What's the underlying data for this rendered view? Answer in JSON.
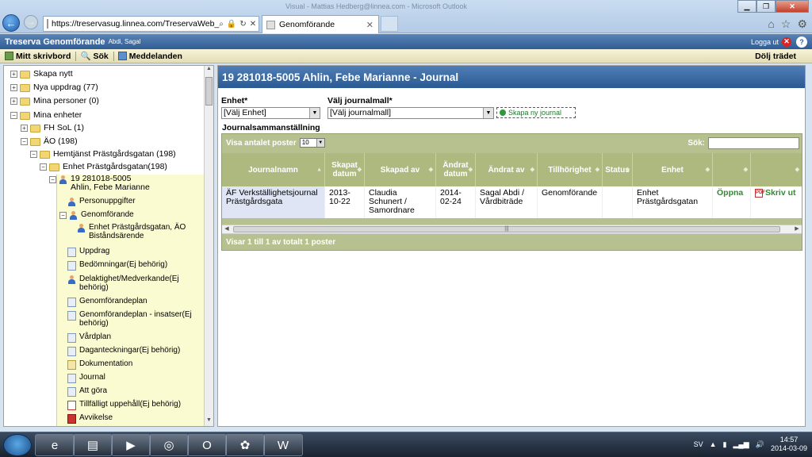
{
  "browser": {
    "window_title": "Visual - Mattias Hedberg@linnea.com - Microsoft Outlook",
    "address": "https://treservasug.linnea.com/TreservaWeb_",
    "tab_label": "Genomförande",
    "back_glyph": "←",
    "forward_glyph": "→"
  },
  "app": {
    "title": "Treserva Genomförande",
    "user": "Abdi, Sagal",
    "logout": "Logga ut"
  },
  "toolbar": {
    "my_desk": "Mitt skrivbord",
    "search": "Sök",
    "messages": "Meddelanden",
    "hide_tree": "Dölj trädet"
  },
  "tree": {
    "create_new": "Skapa nytt",
    "new_tasks": "Nya uppdrag (77)",
    "my_persons": "Mina personer (0)",
    "my_units": "Mina enheter",
    "fh_sol": "FH SoL (1)",
    "ao": "ÄO (198)",
    "hemtjanst": "Hemtjänst Prästgårdsgatan (198)",
    "enhet": "Enhet Prästgårdsgatan(198)",
    "person_id": "19 281018-5005",
    "person_name": "Ahlin, Febe Marianne",
    "sub_items": [
      "Personuppgifter",
      "Genomförande",
      "Enhet Prästgårdsgatan, ÄO Biståndsärende",
      "Uppdrag",
      "Bedömningar(Ej behörig)",
      "Delaktighet/Medverkande(Ej behörig)",
      "Genomförandeplan",
      "Genomförandeplan - insatser(Ej behörig)",
      "Vårdplan",
      "Daganteckningar(Ej behörig)",
      "Dokumentation",
      "Journal",
      "Att göra",
      "Tillfälligt uppehåll(Ej behörig)",
      "Avvikelse"
    ]
  },
  "main": {
    "heading": "19 281018-5005 Ahlin, Febe Marianne - Journal",
    "unit_label": "Enhet*",
    "unit_value": "[Välj Enhet]",
    "template_label": "Välj journalmall*",
    "template_value": "[Välj journalmall]",
    "new_journal": "Skapa ny journal",
    "summary_title": "Journalsammanställning",
    "show_entries_label": "Visa antalet poster",
    "show_entries_value": "10",
    "search_label": "Sök:",
    "columns": [
      "Journalnamn",
      "Skapat datum",
      "Skapad av",
      "Ändrat datum",
      "Ändrat av",
      "Tillhörighet",
      "Status",
      "Enhet",
      "",
      ""
    ],
    "row": {
      "name": "ÄF Verkställighetsjournal Prästgårdsgata",
      "created": "2013-10-22",
      "created_by": "Claudia Schunert / Samordnare",
      "changed": "2014-02-24",
      "changed_by": "Sagal Abdi / Vårdbiträde",
      "belonging": "Genomförande",
      "status": "",
      "unit": "Enhet Prästgårdsgatan",
      "open": "Öppna",
      "print": "Skriv ut"
    },
    "footer": "Visar 1 till 1 av totalt 1 poster"
  },
  "taskbar": {
    "lang": "SV",
    "time": "14:57",
    "date": "2014-03-09"
  }
}
